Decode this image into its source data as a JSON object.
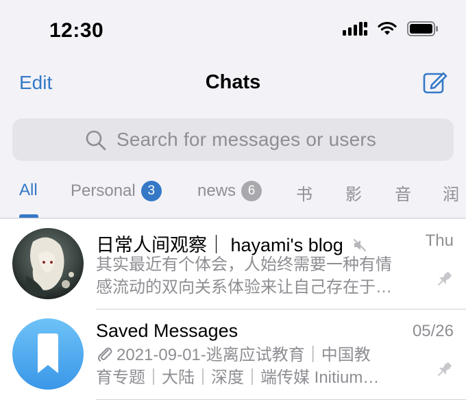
{
  "status": {
    "time": "12:30"
  },
  "nav": {
    "edit_label": "Edit",
    "title": "Chats"
  },
  "search": {
    "placeholder": "Search for messages or users"
  },
  "filters": [
    {
      "label": "All",
      "active": true
    },
    {
      "label": "Personal",
      "badge": "3",
      "badge_color": "#3478c6"
    },
    {
      "label": "news",
      "badge": "6",
      "badge_color": "#a8a8ad"
    },
    {
      "label": "书"
    },
    {
      "label": "影"
    },
    {
      "label": "音"
    },
    {
      "label": "润"
    }
  ],
  "chats": [
    {
      "title": "日常人间观察｜ hayami's blog",
      "muted": true,
      "date": "Thu",
      "preview_line1": "其实最近有个体会，人始终需要一种有情",
      "preview_line2": "感流动的双向关系体验来让自己存在于…",
      "pinned": true
    },
    {
      "title": "Saved Messages",
      "date": "05/26",
      "preview_line1": "2021-09-01-逃离应试教育｜中国教",
      "preview_line2": "育专题｜大陆｜深度｜端传媒 Initium…",
      "pinned": true
    }
  ],
  "colors": {
    "accent": "#3478c6",
    "secondary_text": "#8e8e93",
    "background": "#f2f2f7"
  }
}
